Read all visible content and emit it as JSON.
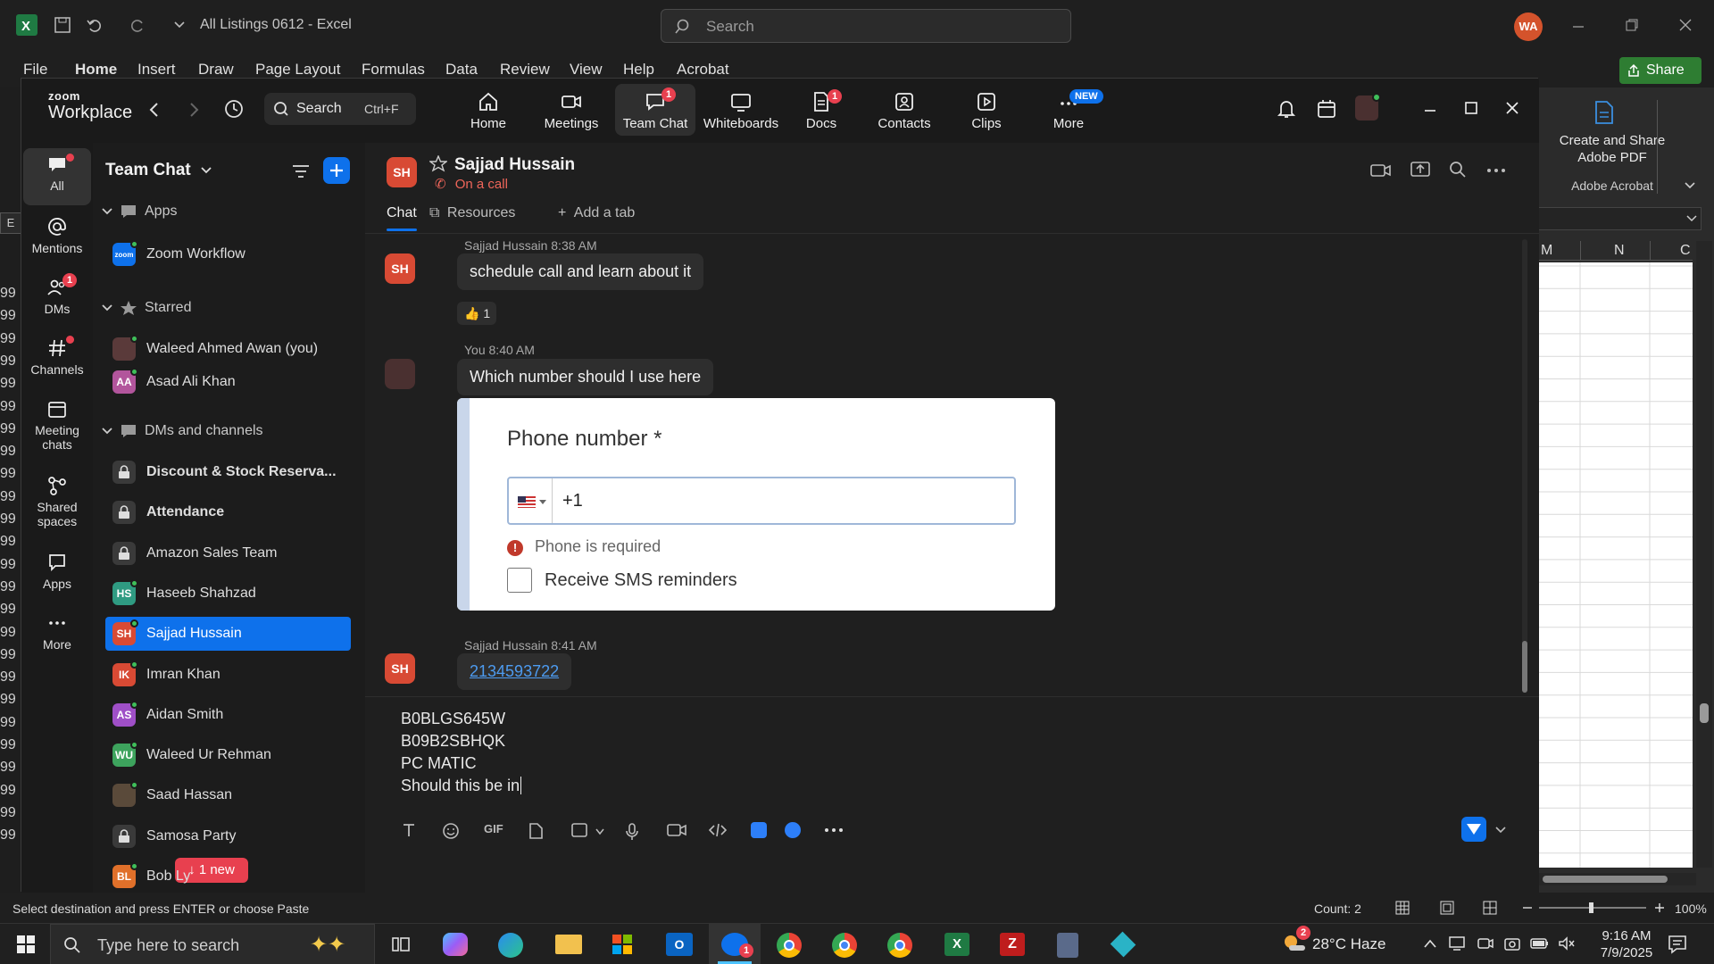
{
  "excel": {
    "title": "All Listings 0612  -  Excel",
    "search_placeholder": "Search",
    "user_initials": "WA",
    "share_label": "Share",
    "ribbon_tabs": [
      "File",
      "Home",
      "Insert",
      "Draw",
      "Page Layout",
      "Formulas",
      "Data",
      "Review",
      "View",
      "Help",
      "Acrobat"
    ],
    "acrobat_button": "Create and Share Adobe PDF",
    "acrobat_group": "Adobe Acrobat",
    "col_headers": [
      "M",
      "N",
      "C"
    ],
    "row_numbers": [
      "99",
      "99",
      "99",
      "99",
      "99",
      "99",
      "99",
      "99",
      "99",
      "99",
      "99",
      "99",
      "99",
      "99",
      "99",
      "99",
      "99",
      "99",
      "99",
      "99",
      "99",
      "99",
      "99",
      "99",
      "99"
    ],
    "status_text": "Select destination and press ENTER or choose Paste",
    "count_text": "Count: 2",
    "zoom_level": "100%"
  },
  "zoom": {
    "logo_top": "zoom",
    "logo_bottom": "Workplace",
    "search_label": "Search",
    "search_shortcut": "Ctrl+F",
    "nav": [
      {
        "label": "Home",
        "icon": "home-icon"
      },
      {
        "label": "Meetings",
        "icon": "video-icon"
      },
      {
        "label": "Team Chat",
        "icon": "chat-icon",
        "badge": "1"
      },
      {
        "label": "Whiteboards",
        "icon": "whiteboard-icon"
      },
      {
        "label": "Docs",
        "icon": "docs-icon",
        "badge": "1"
      },
      {
        "label": "Contacts",
        "icon": "contacts-icon"
      },
      {
        "label": "Clips",
        "icon": "clips-icon"
      },
      {
        "label": "More",
        "icon": "more-icon",
        "badge": "NEW"
      }
    ],
    "rail": [
      {
        "label": "All"
      },
      {
        "label": "Mentions"
      },
      {
        "label": "DMs",
        "badge": "1"
      },
      {
        "label": "Channels"
      },
      {
        "label": "Meeting chats"
      },
      {
        "label": "Shared spaces"
      },
      {
        "label": "Apps"
      },
      {
        "label": "More"
      }
    ],
    "sidebar": {
      "title": "Team Chat",
      "sections": {
        "apps": "Apps",
        "starred": "Starred",
        "dms": "DMs and channels"
      },
      "apps_items": [
        {
          "name": "Zoom Workflow"
        }
      ],
      "starred_items": [
        {
          "name": "Waleed Ahmed Awan (you)",
          "initials": "",
          "color": "#5a3a3a"
        },
        {
          "name": "Asad Ali Khan",
          "initials": "AA",
          "color": "#b2559c"
        }
      ],
      "dm_items": [
        {
          "name": "Discount & Stock Reserva...",
          "initials": "",
          "color": "#3a3a3a",
          "locked": true,
          "bold": true
        },
        {
          "name": "Attendance",
          "initials": "",
          "color": "#3a3a3a",
          "locked": true,
          "bold": true
        },
        {
          "name": "Amazon Sales Team",
          "initials": "",
          "color": "#3a3a3a",
          "locked": true
        },
        {
          "name": "Haseeb Shahzad",
          "initials": "HS",
          "color": "#2f9b82"
        },
        {
          "name": "Sajjad Hussain",
          "initials": "SH",
          "color": "#d84a34",
          "active": true
        },
        {
          "name": "Imran Khan",
          "initials": "IK",
          "color": "#d84a34"
        },
        {
          "name": "Aidan Smith",
          "initials": "AS",
          "color": "#9f4fc7"
        },
        {
          "name": "Waleed Ur Rehman",
          "initials": "WU",
          "color": "#3da35d"
        },
        {
          "name": "Saad Hassan",
          "initials": "",
          "color": "#5a4a3a"
        },
        {
          "name": "Samosa Party",
          "initials": "",
          "color": "#3a3a3a",
          "locked": true
        },
        {
          "name": "Bob Ly",
          "initials": "BL",
          "color": "#e0702a"
        }
      ],
      "new_pill": "1 new"
    },
    "chat": {
      "contact_name": "Sajjad Hussain",
      "contact_initials": "SH",
      "status": "On a call",
      "tabs": [
        "Chat",
        "Resources",
        "Add a tab"
      ],
      "messages": [
        {
          "meta": "Sajjad Hussain  8:38 AM",
          "text": "schedule call and learn about it",
          "reaction": "1"
        },
        {
          "meta": "You  8:40 AM",
          "text": "Which number should I use here"
        },
        {
          "meta": "Sajjad Hussain  8:41 AM",
          "text": "2134593722"
        }
      ],
      "screenshot": {
        "title": "Phone number *",
        "value": "+1",
        "error": "Phone is required",
        "checkbox_label": "Receive SMS reminders"
      },
      "compose_lines": [
        "B0BLGS645W",
        "B09B2SBHQK",
        "PC MATIC",
        "Should this be in"
      ]
    }
  },
  "taskbar": {
    "search_placeholder": "Type here to search",
    "weather": "28°C  Haze",
    "time": "9:16 AM",
    "date": "7/9/2025",
    "chrome_badge": "1",
    "filezilla_badge": "1",
    "weather_badge": "2"
  }
}
